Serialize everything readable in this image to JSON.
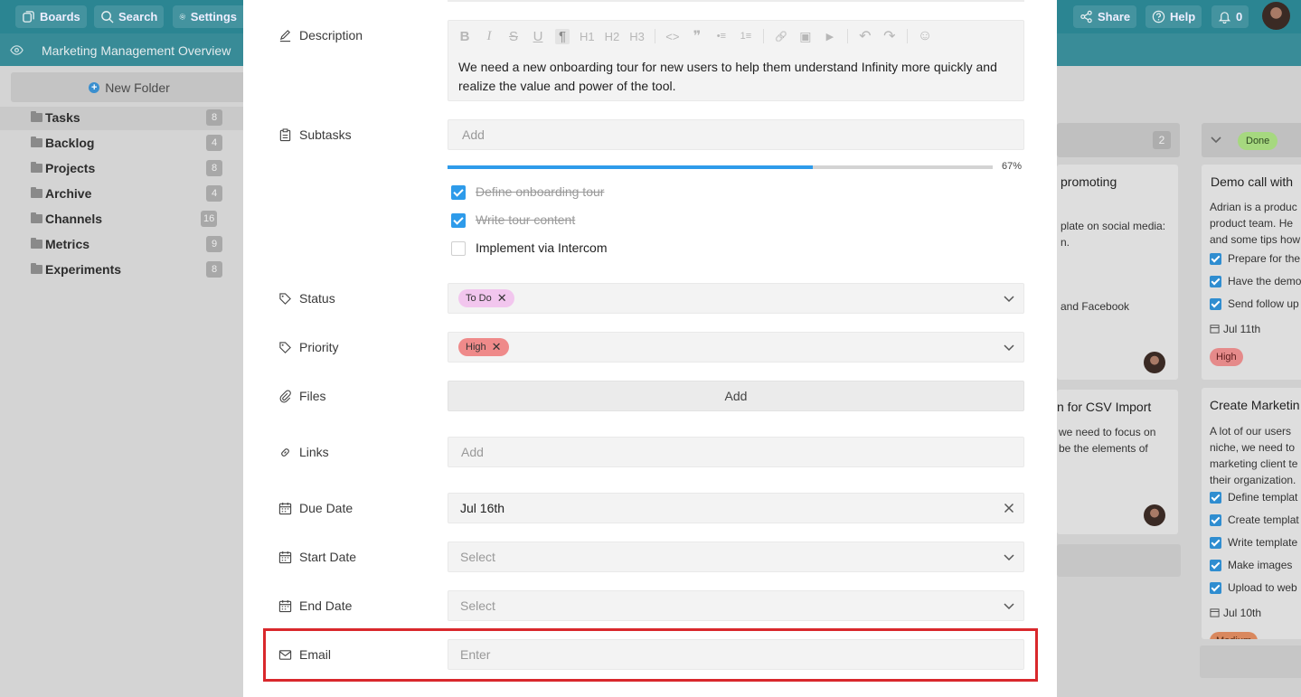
{
  "topbar": {
    "boards_label": "Boards",
    "search_label": "Search",
    "settings_label": "Settings",
    "share_label": "Share",
    "help_label": "Help",
    "notifications_count": "0"
  },
  "boardbar": {
    "title": "Marketing Management Overview"
  },
  "sidebar": {
    "new_folder_label": "New Folder",
    "folders": [
      {
        "name": "Tasks",
        "count": "8"
      },
      {
        "name": "Backlog",
        "count": "4"
      },
      {
        "name": "Projects",
        "count": "8"
      },
      {
        "name": "Archive",
        "count": "4"
      },
      {
        "name": "Channels",
        "count": "16"
      },
      {
        "name": "Metrics",
        "count": "9"
      },
      {
        "name": "Experiments",
        "count": "8"
      }
    ]
  },
  "board": {
    "col1_count": "2",
    "col1_card1_title": "promoting",
    "col1_card1_line1": "plate on social media:",
    "col1_card1_line2": "n.",
    "col1_card1_line3": "and Facebook",
    "col1_card2_title": "n for CSV Import",
    "col1_card2_line1": "we need to focus on",
    "col1_card2_line2": "be the elements of",
    "done_label": "Done",
    "card_a_title": "Demo call with",
    "card_a_lines": [
      "Adrian is a produc",
      "product team. He",
      "and some tips how"
    ],
    "card_a_checks": [
      "Prepare for the",
      "Have the demo",
      "Send follow up"
    ],
    "card_a_date": "Jul 11th",
    "card_a_priority": "High",
    "card_b_title": "Create Marketin",
    "card_b_lines": [
      "A lot of our users",
      "niche, we need to",
      "marketing client te",
      "their organization."
    ],
    "card_b_checks": [
      "Define templat",
      "Create templat",
      "Write template",
      "Make images",
      "Upload to web"
    ],
    "card_b_date": "Jul 10th",
    "card_b_priority": "Medium"
  },
  "modal": {
    "description": {
      "label": "Description",
      "toolbar": [
        "B",
        "I",
        "S",
        "U",
        "¶",
        "H1",
        "H2",
        "H3",
        "<>",
        "❞",
        "•≡",
        "1≡",
        "🔗",
        "▣",
        "▶",
        "↶",
        "↷",
        "☺"
      ],
      "text": "We need a new onboarding tour for new users to help them understand Infinity more quickly and realize the value and power of the tool."
    },
    "subtasks": {
      "label": "Subtasks",
      "placeholder": "Add",
      "progress_text": "67%",
      "progress_value": 0.67,
      "items": [
        {
          "text": "Define onboarding tour",
          "done": true
        },
        {
          "text": "Write tour content",
          "done": true
        },
        {
          "text": "Implement via Intercom",
          "done": false
        }
      ]
    },
    "status": {
      "label": "Status",
      "value": "To Do",
      "color": "#f2c6ee"
    },
    "priority": {
      "label": "Priority",
      "value": "High",
      "color": "#ef8a8a"
    },
    "files": {
      "label": "Files",
      "button": "Add"
    },
    "links": {
      "label": "Links",
      "placeholder": "Add"
    },
    "due_date": {
      "label": "Due Date",
      "value": "Jul 16th"
    },
    "start_date": {
      "label": "Start Date",
      "placeholder": "Select"
    },
    "end_date": {
      "label": "End Date",
      "placeholder": "Select"
    },
    "email": {
      "label": "Email",
      "placeholder": "Enter"
    }
  },
  "colors": {
    "topbar": "#2b8592",
    "accent_blue": "#2e9bea",
    "highlight": "#d9282c"
  }
}
